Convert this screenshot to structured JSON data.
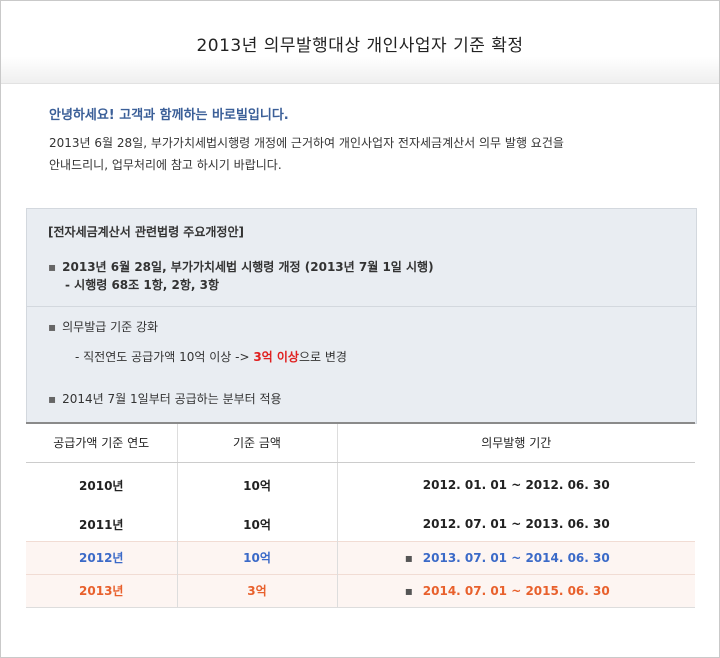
{
  "title": "2013년 의무발행대상 개인사업자 기준 확정",
  "greeting": "안녕하세요! 고객과 함께하는 바로빌입니다.",
  "intro_lines": [
    "2013년 6월 28일, 부가가치세법시행령 개정에 근거하여 개인사업자 전자세금계산서 의무 발행 요건을",
    "안내드리니, 업무처리에 참고 하시기 바랍니다."
  ],
  "panel": {
    "heading": "[전자세금계산서 관련법령 주요개정안]",
    "item1": "2013년 6월 28일, 부가가치세법 시행령 개정 (2013년 7월 1일 시행)",
    "item1_sub": "- 시행령 68조 1항, 2항, 3항",
    "item2": "의무발급 기준 강화",
    "item2_sub_prefix": "- 직전연도 공급가액 10억 이상 ->",
    "item2_sub_highlight": "3억 이상",
    "item2_sub_suffix": "으로 변경",
    "item3": "2014년 7월 1일부터 공급하는 분부터 적용",
    "bullet_symbol": "▪"
  },
  "table": {
    "headers": [
      "공급가액 기준 연도",
      "기준 금액",
      "의무발행 기간"
    ],
    "rows": [
      {
        "year": "2010년",
        "amount": "10억",
        "period": "2012. 01. 01 ~ 2012. 06. 30",
        "marker": ""
      },
      {
        "year": "2011년",
        "amount": "10억",
        "period": "2012. 07. 01 ~ 2013. 06. 30",
        "marker": ""
      },
      {
        "year": "2012년",
        "amount": "10억",
        "period": "2013. 07. 01 ~ 2014. 06. 30",
        "marker": "▪"
      },
      {
        "year": "2013년",
        "amount": "3억",
        "period": "2014. 07. 01 ~ 2015. 06. 30",
        "marker": "▪"
      }
    ]
  },
  "colors": {
    "greeting": "#3b5f98",
    "highlight_red": "#e02020",
    "row_blue": "#3b6ac8",
    "row_orange": "#e8602c",
    "panel_bg": "#e9edf2"
  }
}
